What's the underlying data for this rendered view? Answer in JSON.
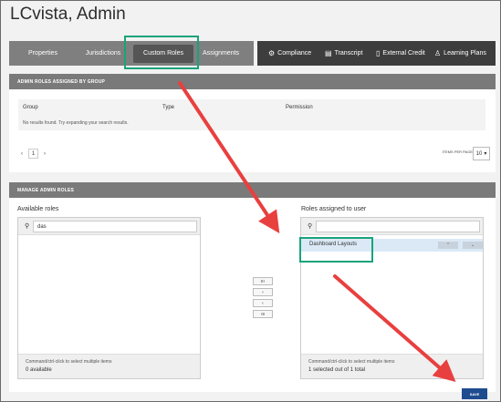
{
  "page": {
    "title": "LCvista, Admin"
  },
  "tabs_left": [
    {
      "label": "Properties"
    },
    {
      "label": "Jurisdictions"
    },
    {
      "label": "Custom Roles"
    },
    {
      "label": "Assignments"
    }
  ],
  "tabs_right": [
    {
      "label": "Compliance",
      "icon": "gear-icon"
    },
    {
      "label": "Transcript",
      "icon": "transcript-icon"
    },
    {
      "label": "External Credit",
      "icon": "document-icon"
    },
    {
      "label": "Learning Plans",
      "icon": "person-icon"
    }
  ],
  "roles_by_group": {
    "heading": "ADMIN ROLES ASSIGNED BY GROUP",
    "columns": [
      "Group",
      "Type",
      "Permission"
    ],
    "empty_text": "No results found. Try expanding your search results.",
    "pager": {
      "prev": "‹",
      "page": "1",
      "next": "›"
    },
    "items_per_page_label": "ITEMS PER PAGE",
    "items_per_page": "10"
  },
  "manage": {
    "heading": "MANAGE ADMIN ROLES",
    "available": {
      "label": "Available roles",
      "search_value": "das",
      "hint": "Command/ctrl-click to select multiple items",
      "count": "0 available"
    },
    "assigned": {
      "label": "Roles assigned to user",
      "search_value": "",
      "items": [
        {
          "label": "Dashboard Layouts"
        }
      ],
      "hint": "Command/ctrl-click to select multiple items",
      "count": "1 selected out of 1 total"
    },
    "move_buttons": [
      "≡›",
      "›",
      "‹",
      "‹≡"
    ]
  },
  "save_label": "SAVE",
  "colors": {
    "highlight": "#1aa37a",
    "arrow": "#e8403f",
    "save": "#1f4b8f"
  }
}
